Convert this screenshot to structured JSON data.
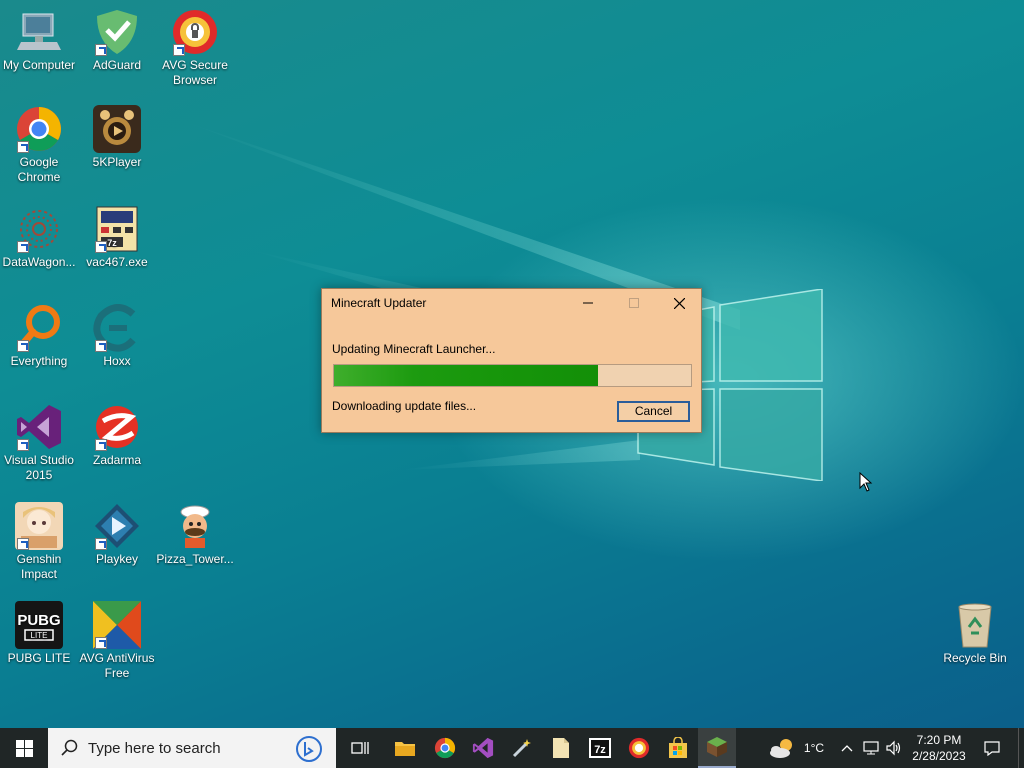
{
  "desktop": {
    "icons": [
      {
        "label": "My Computer",
        "icon": "computer-icon"
      },
      {
        "label": "AdGuard",
        "icon": "adguard-icon"
      },
      {
        "label": "AVG Secure Browser",
        "icon": "avg-browser-icon"
      },
      {
        "label": "Google Chrome",
        "icon": "chrome-icon"
      },
      {
        "label": "5KPlayer",
        "icon": "5kplayer-icon"
      },
      {
        "label": "DataWagon...",
        "icon": "datawagon-icon"
      },
      {
        "label": "vac467.exe",
        "icon": "vac-exe-icon"
      },
      {
        "label": "Everything",
        "icon": "everything-icon"
      },
      {
        "label": "Hoxx",
        "icon": "hoxx-icon"
      },
      {
        "label": "Visual Studio 2015",
        "icon": "visual-studio-icon"
      },
      {
        "label": "Zadarma",
        "icon": "zadarma-icon"
      },
      {
        "label": "Genshin Impact",
        "icon": "genshin-icon"
      },
      {
        "label": "Playkey",
        "icon": "playkey-icon"
      },
      {
        "label": "Pizza_Tower...",
        "icon": "pizza-tower-icon"
      },
      {
        "label": "PUBG LITE",
        "icon": "pubg-icon"
      },
      {
        "label": "AVG AntiVirus Free",
        "icon": "avg-antivirus-icon"
      },
      {
        "label": "Recycle Bin",
        "icon": "recycle-bin-icon"
      }
    ]
  },
  "dialog": {
    "title": "Minecraft Updater",
    "status": "Updating Minecraft Launcher...",
    "progress": 0.74,
    "detail": "Downloading update files...",
    "cancel_label": "Cancel"
  },
  "taskbar": {
    "search_placeholder": "Type here to search",
    "weather_temp": "1°C",
    "time": "7:20 PM",
    "date": "2/28/2023",
    "pinned": [
      "task-view-icon",
      "file-explorer-icon",
      "chrome-icon",
      "visual-studio-icon",
      "wand-icon",
      "notepad-icon",
      "7zip-icon",
      "avg-browser-icon",
      "store-icon",
      "minecraft-icon"
    ]
  },
  "colors": {
    "dialog_bg": "#f6c89a",
    "progress_green": "#17960b",
    "taskbar_bg": "#202626"
  }
}
